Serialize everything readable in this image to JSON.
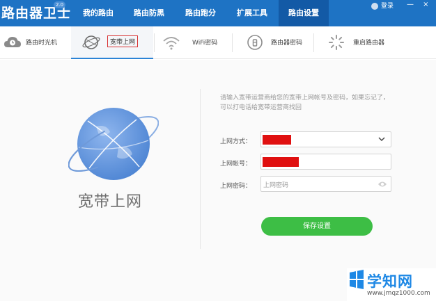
{
  "app": {
    "title": "路由器卫士",
    "version": "2.0",
    "user": "登录",
    "window_controls": "— ×"
  },
  "nav": {
    "tabs": [
      {
        "label": "我的路由"
      },
      {
        "label": "路由防黑"
      },
      {
        "label": "路由跑分"
      },
      {
        "label": "扩展工具"
      },
      {
        "label": "路由设置",
        "active": true
      }
    ]
  },
  "subtabs": [
    {
      "label": "路由时光机",
      "icon": "cloud-clock-icon"
    },
    {
      "label": "宽带上网",
      "icon": "globe-icon",
      "active": true
    },
    {
      "label": "WiFi密码",
      "icon": "wifi-icon"
    },
    {
      "label": "路由器密码",
      "icon": "router-lock-icon"
    },
    {
      "label": "重启路由器",
      "icon": "restart-spinner-icon"
    }
  ],
  "panel": {
    "caption": "宽带上网",
    "hint_line1": "请输入宽带运营商给您的宽带上网帐号及密码，如果忘记了，",
    "hint_line2": "可以打电话给宽带运营商找回",
    "fields": {
      "mode_label": "上网方式：",
      "account_label": "上网帐号：",
      "password_label": "上网密码：",
      "password_placeholder": "上网密码"
    },
    "save_label": "保存设置"
  },
  "watermark": {
    "title": "学知网",
    "url": "www.jmqz1000.com"
  },
  "colors": {
    "header": "#1e73c4",
    "header_active": "#135aa6",
    "save": "#3dbe45",
    "redaction": "#e01010",
    "active_border": "#d83030"
  }
}
